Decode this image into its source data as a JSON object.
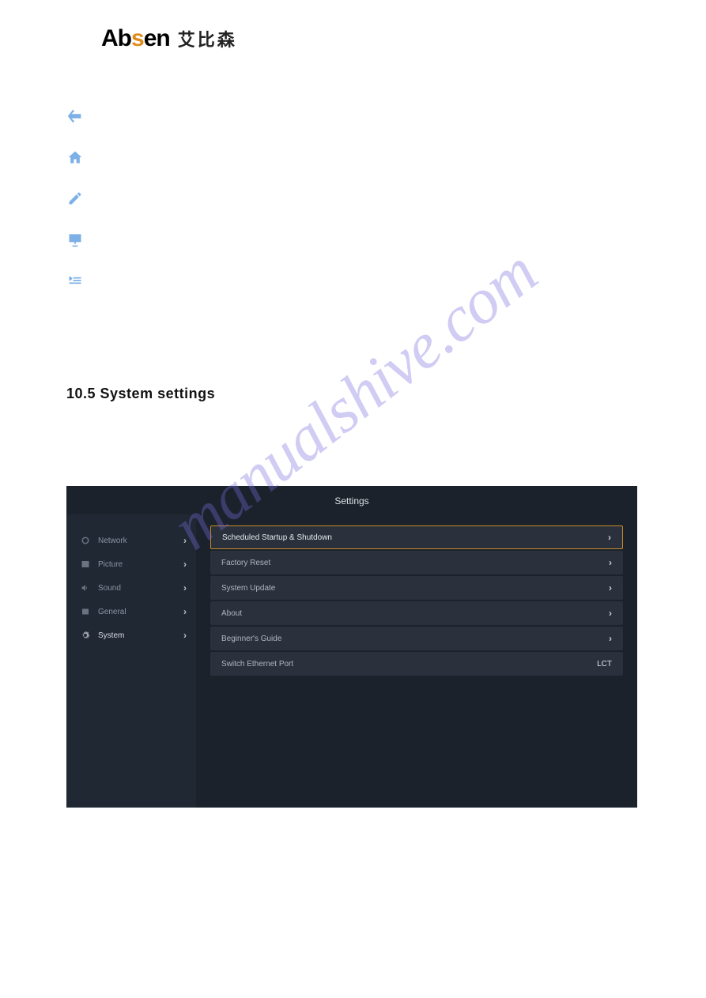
{
  "logo": {
    "brand_pre": "Ab",
    "brand_mid": "s",
    "brand_post": "en",
    "cn": "艾比森"
  },
  "toolbar": {
    "items": [
      {
        "name": "back-icon"
      },
      {
        "name": "home-icon"
      },
      {
        "name": "edit-icon"
      },
      {
        "name": "presentation-icon"
      },
      {
        "name": "menu-collapse-icon"
      }
    ]
  },
  "heading": "10.5  System  settings",
  "settings": {
    "title": "Settings",
    "sidebar": [
      {
        "icon": "network-icon",
        "label": "Network"
      },
      {
        "icon": "picture-icon",
        "label": "Picture"
      },
      {
        "icon": "sound-icon",
        "label": "Sound"
      },
      {
        "icon": "general-icon",
        "label": "General"
      },
      {
        "icon": "system-icon",
        "label": "System",
        "active": true
      }
    ],
    "rows": [
      {
        "label": "Scheduled Startup & Shutdown",
        "selected": true
      },
      {
        "label": "Factory Reset"
      },
      {
        "label": "System Update"
      },
      {
        "label": "About"
      },
      {
        "label": "Beginner's Guide"
      },
      {
        "label": "Switch Ethernet Port",
        "value": "LCT"
      }
    ]
  },
  "watermark": "manualshive.com"
}
